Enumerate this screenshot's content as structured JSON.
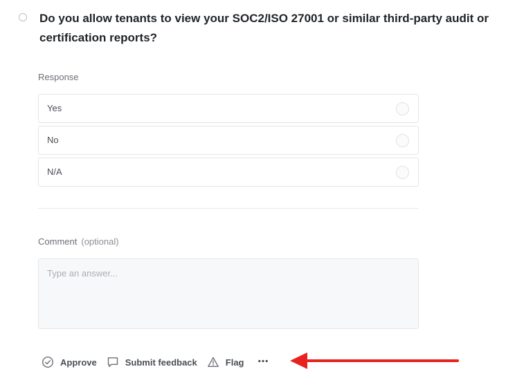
{
  "question": {
    "title": "Do you allow tenants to view your SOC2/ISO 27001 or similar third-party audit or certification reports?"
  },
  "response": {
    "label": "Response",
    "options": [
      {
        "label": "Yes"
      },
      {
        "label": "No"
      },
      {
        "label": "N/A"
      }
    ]
  },
  "comment": {
    "label": "Comment",
    "optional_tag": "(optional)",
    "placeholder": "Type an answer..."
  },
  "actions": {
    "approve_label": "Approve",
    "submit_feedback_label": "Submit feedback",
    "flag_label": "Flag",
    "more_icon": "more-horizontal-icon"
  },
  "colors": {
    "annotation_arrow": "#e8231f",
    "icon_gray": "#6b6f76"
  }
}
